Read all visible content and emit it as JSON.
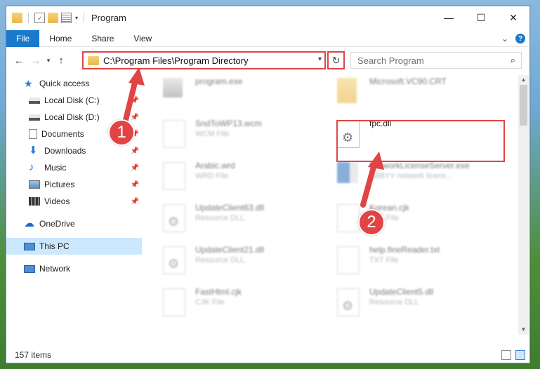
{
  "window": {
    "title": "Program"
  },
  "titlebar": {
    "minimize": "—",
    "maximize": "☐",
    "close": "✕"
  },
  "ribbon": {
    "tabs": [
      "File",
      "Home",
      "Share",
      "View"
    ],
    "expand": "⌄",
    "help": "?"
  },
  "address": {
    "path": "C:\\Program Files\\Program Directory",
    "search_placeholder": "Search Program"
  },
  "nav": {
    "items": [
      {
        "label": "Quick access"
      },
      {
        "label": "Local Disk (C:)"
      },
      {
        "label": "Local Disk (D:)"
      },
      {
        "label": "Documents"
      },
      {
        "label": "Downloads"
      },
      {
        "label": "Music"
      },
      {
        "label": "Pictures"
      },
      {
        "label": "Videos"
      },
      {
        "label": "OneDrive"
      },
      {
        "label": "This PC"
      },
      {
        "label": "Network"
      }
    ]
  },
  "files": [
    {
      "name": "program.exe",
      "sub": ""
    },
    {
      "name": "Microsoft.VC90.CRT",
      "sub": ""
    },
    {
      "name": "SndToWP13.wcm",
      "sub": "WCM File"
    },
    {
      "name": "fpc.dll",
      "sub": ""
    },
    {
      "name": "Arabic.wrd",
      "sub": "WRD File"
    },
    {
      "name": "NetworkLicenseServer.exe",
      "sub": "ABBYY network licens..."
    },
    {
      "name": "UpdateClient63.dll",
      "sub": "Resource DLL"
    },
    {
      "name": "Korean.cjk",
      "sub": "CJK File"
    },
    {
      "name": "UpdateClient21.dll",
      "sub": "Resource DLL"
    },
    {
      "name": "help.fineReader.txt",
      "sub": "TXT File"
    },
    {
      "name": "FastHtml.cjk",
      "sub": "CJK File"
    },
    {
      "name": "UpdateClient5.dll",
      "sub": "Resource DLL"
    }
  ],
  "status": {
    "count": "157 items"
  },
  "markers": {
    "one": "1",
    "two": "2"
  },
  "colors": {
    "accent": "#1979ca",
    "highlight": "#e04444",
    "selected": "#cce8ff"
  }
}
